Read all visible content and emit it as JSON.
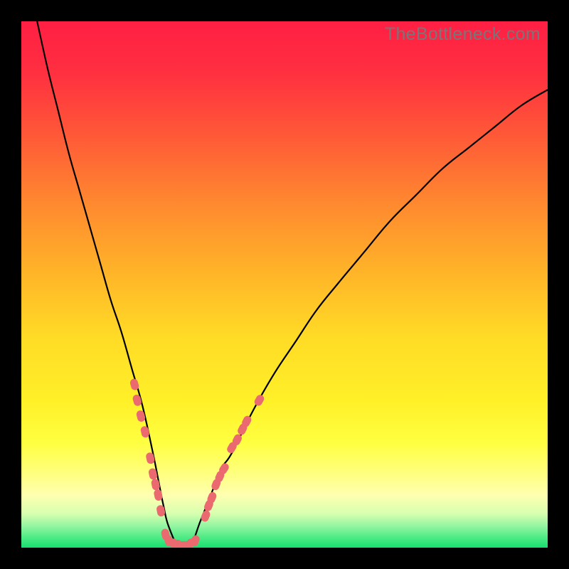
{
  "watermark": "TheBottleneck.com",
  "gradient": {
    "stops": [
      {
        "offset": 0.0,
        "color": "#ff1f44"
      },
      {
        "offset": 0.1,
        "color": "#ff3040"
      },
      {
        "offset": 0.22,
        "color": "#ff5a37"
      },
      {
        "offset": 0.35,
        "color": "#ff8a2f"
      },
      {
        "offset": 0.48,
        "color": "#ffb528"
      },
      {
        "offset": 0.6,
        "color": "#ffdb26"
      },
      {
        "offset": 0.72,
        "color": "#fff028"
      },
      {
        "offset": 0.8,
        "color": "#ffff40"
      },
      {
        "offset": 0.86,
        "color": "#ffff80"
      },
      {
        "offset": 0.9,
        "color": "#ffffb0"
      },
      {
        "offset": 0.935,
        "color": "#d8ffb0"
      },
      {
        "offset": 0.96,
        "color": "#90f5a0"
      },
      {
        "offset": 0.985,
        "color": "#40e880"
      },
      {
        "offset": 1.0,
        "color": "#18df70"
      }
    ]
  },
  "colors": {
    "curve_stroke": "#000000",
    "marker_fill": "#ea6a6f",
    "marker_stroke": "#ea6a6f"
  },
  "chart_data": {
    "type": "line",
    "title": "",
    "xlabel": "",
    "ylabel": "",
    "xlim": [
      0,
      100
    ],
    "ylim": [
      0,
      100
    ],
    "legend": false,
    "grid": false,
    "series": [
      {
        "name": "bottleneck-curve",
        "x": [
          3,
          5,
          7,
          9,
          11,
          13,
          15,
          17,
          19,
          21,
          23,
          25,
          26,
          27,
          28,
          30,
          32,
          34,
          36,
          38,
          40,
          44,
          48,
          52,
          56,
          60,
          65,
          70,
          75,
          80,
          85,
          90,
          95,
          100
        ],
        "y": [
          100,
          91,
          83,
          75,
          68,
          61,
          54,
          47,
          41,
          34,
          27,
          18,
          13,
          8,
          4,
          0,
          0,
          5,
          10,
          15,
          18,
          26,
          33,
          39,
          45,
          50,
          56,
          62,
          67,
          72,
          76,
          80,
          84,
          87
        ]
      }
    ],
    "markers": [
      {
        "x": 21.5,
        "y": 31
      },
      {
        "x": 22.0,
        "y": 28
      },
      {
        "x": 22.7,
        "y": 25
      },
      {
        "x": 23.5,
        "y": 22
      },
      {
        "x": 24.5,
        "y": 17
      },
      {
        "x": 25.0,
        "y": 14
      },
      {
        "x": 25.5,
        "y": 12
      },
      {
        "x": 26.0,
        "y": 10
      },
      {
        "x": 26.5,
        "y": 7
      },
      {
        "x": 27.4,
        "y": 2.5
      },
      {
        "x": 28.0,
        "y": 1.3
      },
      {
        "x": 29.0,
        "y": 0.7
      },
      {
        "x": 30.0,
        "y": 0.5
      },
      {
        "x": 31.0,
        "y": 0.5
      },
      {
        "x": 32.0,
        "y": 0.7
      },
      {
        "x": 33.0,
        "y": 1.3
      },
      {
        "x": 35.0,
        "y": 6
      },
      {
        "x": 35.6,
        "y": 8
      },
      {
        "x": 36.2,
        "y": 9.5
      },
      {
        "x": 37.0,
        "y": 12
      },
      {
        "x": 37.7,
        "y": 13.5
      },
      {
        "x": 38.5,
        "y": 15
      },
      {
        "x": 40.0,
        "y": 19
      },
      {
        "x": 41.0,
        "y": 20.5
      },
      {
        "x": 42.0,
        "y": 22.5
      },
      {
        "x": 42.8,
        "y": 24
      },
      {
        "x": 45.2,
        "y": 28
      }
    ]
  }
}
